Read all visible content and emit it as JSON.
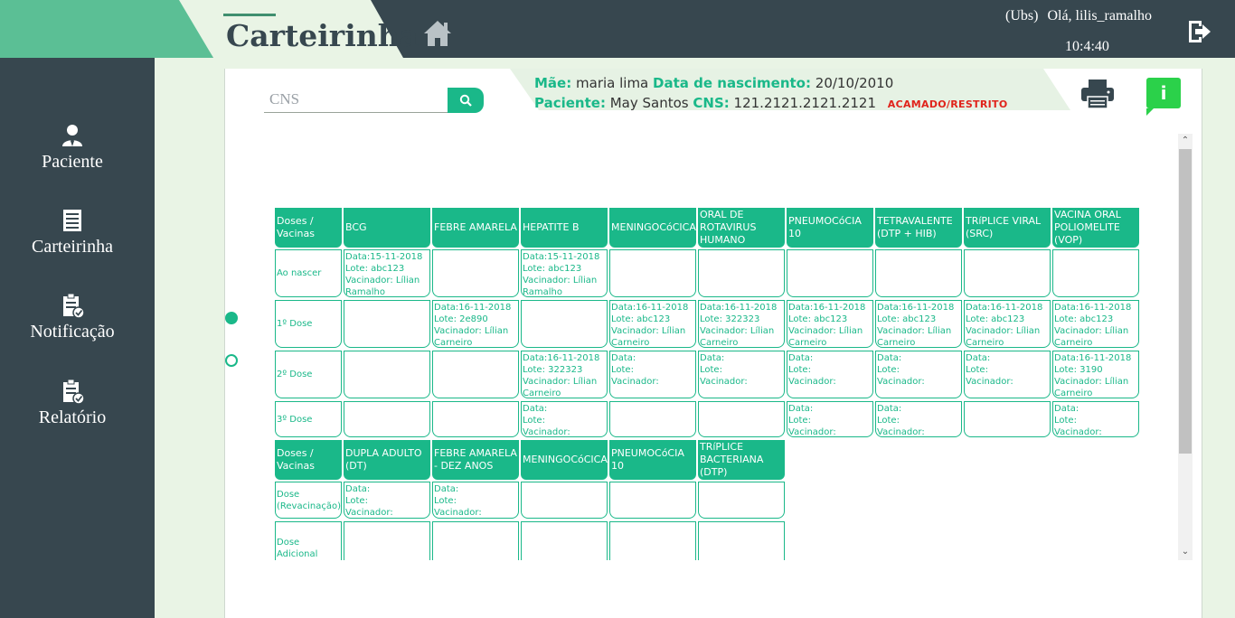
{
  "header": {
    "title": "Carteirinha",
    "ubs": "(Ubs)",
    "greeting": "Olá, lilis_ramalho",
    "time": "10:4:40"
  },
  "sidebar": {
    "items": [
      {
        "label": "Paciente",
        "icon": "user-icon"
      },
      {
        "label": "Carteirinha",
        "icon": "card-list-icon"
      },
      {
        "label": "Notificação",
        "icon": "clipboard-check-icon"
      },
      {
        "label": "Relatório",
        "icon": "clipboard-check-icon"
      }
    ]
  },
  "search": {
    "placeholder": "CNS",
    "value": ""
  },
  "patient": {
    "mother_label": "Mãe:",
    "mother": "maria lima",
    "birth_label": "Data de nascimento:",
    "birth": "20/10/2010",
    "patient_label": "Paciente:",
    "patient": "May Santos",
    "cns_label": "CNS:",
    "cns": "121.2121.2121.2121",
    "status": "ACAMADO/RESTRITO"
  },
  "info_button": "i",
  "colors": {
    "accent": "#1ab889",
    "sidebar": "#37474f",
    "alert": "#e0241b",
    "info_button": "#2bd14a"
  },
  "table1": {
    "corner": "Doses / Vacinas",
    "columns": [
      "BCG",
      "FEBRE AMARELA",
      "HEPATITE B",
      "MENINGOCóCICA",
      "ORAL DE ROTAVIRUS HUMANO",
      "PNEUMOCóCIA 10",
      "TETRAVALENTE (DTP + HIB)",
      "TRíPLICE VIRAL (SRC)",
      "VACINA ORAL POLIOMELITE (VOP)"
    ],
    "rows": [
      {
        "label": "Ao nascer",
        "cells": [
          "Data:15-11-2018\nLote: abc123\nVacinador: Lílian Ramalho",
          "",
          "Data:15-11-2018\nLote: abc123\nVacinador: Lílian Ramalho",
          "",
          "",
          "",
          "",
          "",
          ""
        ]
      },
      {
        "label": "1º Dose",
        "cells": [
          "",
          "Data:16-11-2018\nLote: 2e890\nVacinador: Lílian Carneiro",
          "",
          "Data:16-11-2018\nLote: abc123\nVacinador: Lílian Carneiro",
          "Data:16-11-2018\nLote: 322323\nVacinador: Lílian Carneiro",
          "Data:16-11-2018\nLote: abc123\nVacinador: Lílian Carneiro",
          "Data:16-11-2018\nLote: abc123\nVacinador: Lílian Carneiro",
          "Data:16-11-2018\nLote: abc123\nVacinador: Lílian Carneiro",
          "Data:16-11-2018\nLote: abc123\nVacinador: Lílian Carneiro"
        ]
      },
      {
        "label": "2º Dose",
        "cells": [
          "",
          "",
          "Data:16-11-2018\nLote: 322323\nVacinador: Lílian Carneiro",
          "Data:\nLote:\nVacinador:",
          "Data:\nLote:\nVacinador:",
          "Data:\nLote:\nVacinador:",
          "Data:\nLote:\nVacinador:",
          "Data:\nLote:\nVacinador:",
          "Data:16-11-2018\nLote: 3190\nVacinador: Lílian Carneiro"
        ]
      },
      {
        "label": "3º Dose",
        "cells": [
          "",
          "",
          "Data:\nLote:\nVacinador:",
          "",
          "",
          "Data:\nLote:\nVacinador:",
          "Data:\nLote:\nVacinador:",
          "",
          "Data:\nLote:\nVacinador:"
        ]
      }
    ]
  },
  "table2": {
    "corner": "Doses / Vacinas",
    "columns": [
      "DUPLA ADULTO (DT)",
      "FEBRE AMARELA - DEZ ANOS",
      "MENINGOCóCICA",
      "PNEUMOCóCIA 10",
      "TRíPLICE BACTERIANA (DTP)"
    ],
    "rows": [
      {
        "label": "Dose (Revacinação)",
        "cells": [
          "Data:\nLote:\nVacinador:",
          "Data:\nLote:\nVacinador:",
          "",
          "",
          ""
        ]
      },
      {
        "label": "Dose Adicional",
        "cells": [
          "",
          "",
          "",
          "",
          ""
        ]
      }
    ]
  }
}
